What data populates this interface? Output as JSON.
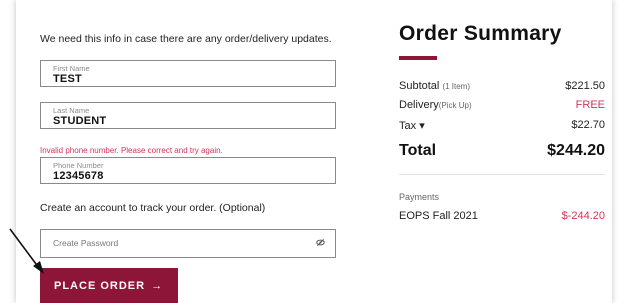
{
  "form": {
    "info_text": "We need this info in case there are any order/delivery updates.",
    "first_name": {
      "label": "First Name",
      "value": "TEST"
    },
    "last_name": {
      "label": "Last Name",
      "value": "STUDENT"
    },
    "error_message": "Invalid phone number. Please correct and try again.",
    "phone": {
      "label": "Phone Number",
      "value": "12345678"
    },
    "account_text": "Create an account to track your order. (Optional)",
    "password": {
      "placeholder": "Create Password",
      "icon": "eye-slash-icon"
    },
    "place_order_label": "PLACE ORDER",
    "place_order_arrow": "→"
  },
  "summary": {
    "title": "Order Summary",
    "subtotal": {
      "label": "Subtotal",
      "note": "(1 Item)",
      "value": "$221.50"
    },
    "delivery": {
      "label": "Delivery",
      "note": "(Pick Up)",
      "value": "FREE"
    },
    "tax": {
      "label": "Tax",
      "chevron": "▾",
      "value": "$22.70"
    },
    "total": {
      "label": "Total",
      "value": "$244.20"
    },
    "payments_label": "Payments",
    "payment": {
      "name": "EOPS Fall 2021",
      "amount": "$-244.20"
    }
  },
  "colors": {
    "accent": "#8c1538",
    "error": "#d6335a"
  }
}
